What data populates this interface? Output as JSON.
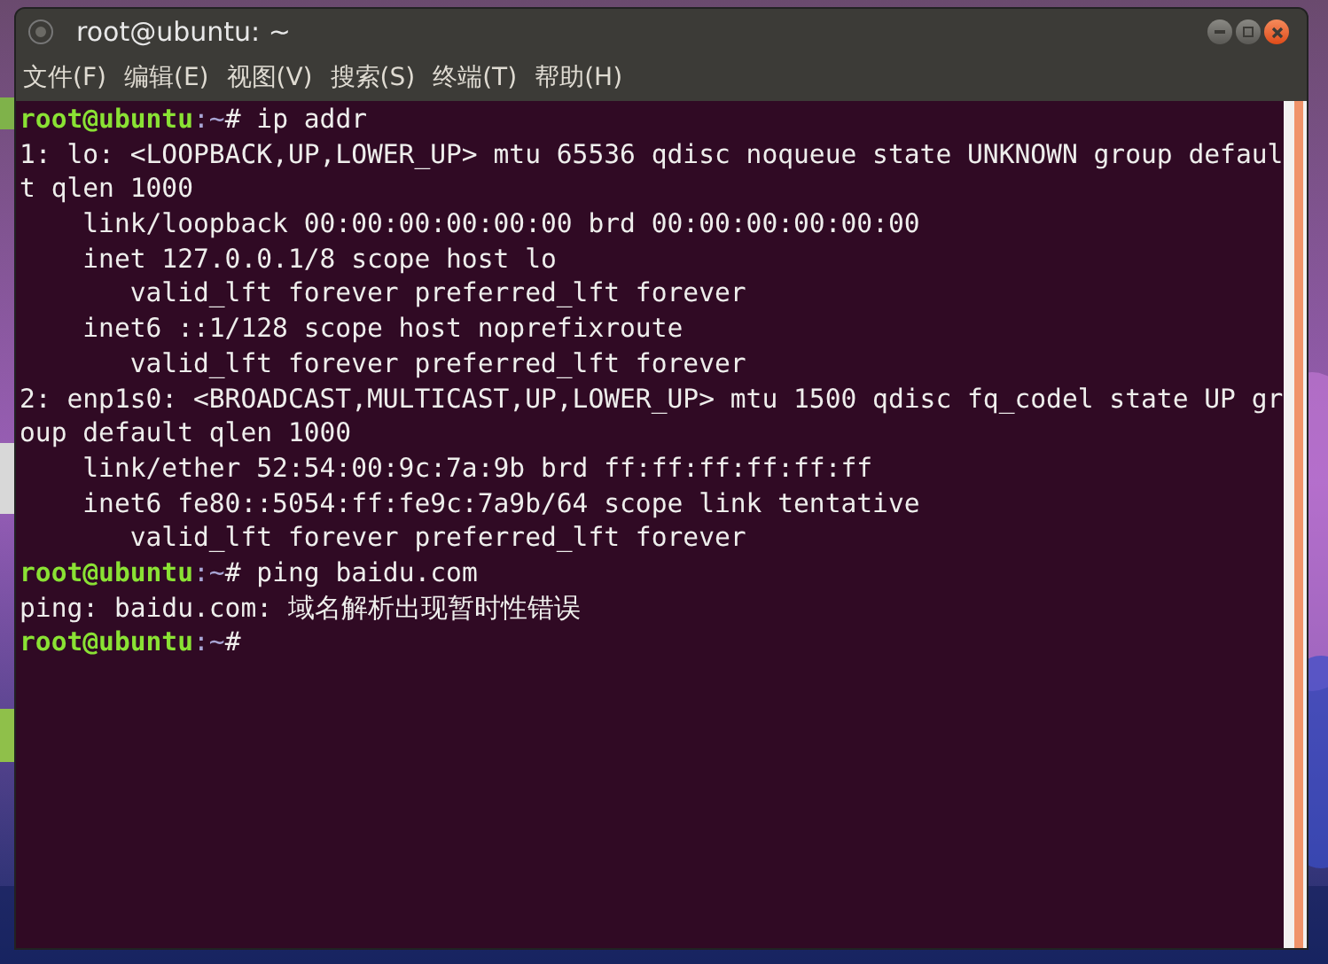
{
  "window": {
    "title": "root@ubuntu: ~"
  },
  "menu": [
    {
      "label": "文件(F)"
    },
    {
      "label": "编辑(E)"
    },
    {
      "label": "视图(V)"
    },
    {
      "label": "搜索(S)"
    },
    {
      "label": "终端(T)"
    },
    {
      "label": "帮助(H)"
    }
  ],
  "terminal": {
    "lines": [
      {
        "kind": "prompt",
        "user": "root@ubuntu",
        "path": ":~",
        "symbol": "#",
        "command": " ip addr"
      },
      {
        "kind": "output",
        "text": "1: lo: <LOOPBACK,UP,LOWER_UP> mtu 65536 qdisc noqueue state UNKNOWN group defaul"
      },
      {
        "kind": "output",
        "text": "t qlen 1000"
      },
      {
        "kind": "output",
        "text": "    link/loopback 00:00:00:00:00:00 brd 00:00:00:00:00:00"
      },
      {
        "kind": "output",
        "text": "    inet 127.0.0.1/8 scope host lo"
      },
      {
        "kind": "output",
        "text": "       valid_lft forever preferred_lft forever"
      },
      {
        "kind": "output",
        "text": "    inet6 ::1/128 scope host noprefixroute"
      },
      {
        "kind": "output",
        "text": "       valid_lft forever preferred_lft forever"
      },
      {
        "kind": "output",
        "text": "2: enp1s0: <BROADCAST,MULTICAST,UP,LOWER_UP> mtu 1500 qdisc fq_codel state UP gr"
      },
      {
        "kind": "output",
        "text": "oup default qlen 1000"
      },
      {
        "kind": "output",
        "text": "    link/ether 52:54:00:9c:7a:9b brd ff:ff:ff:ff:ff:ff"
      },
      {
        "kind": "output",
        "text": "    inet6 fe80::5054:ff:fe9c:7a9b/64 scope link tentative"
      },
      {
        "kind": "output",
        "text": "       valid_lft forever preferred_lft forever"
      },
      {
        "kind": "prompt",
        "user": "root@ubuntu",
        "path": ":~",
        "symbol": "#",
        "command": " ping baidu.com"
      },
      {
        "kind": "output",
        "text": "ping: baidu.com: 域名解析出现暂时性错误"
      },
      {
        "kind": "prompt",
        "user": "root@ubuntu",
        "path": ":~",
        "symbol": "#"
      }
    ]
  }
}
